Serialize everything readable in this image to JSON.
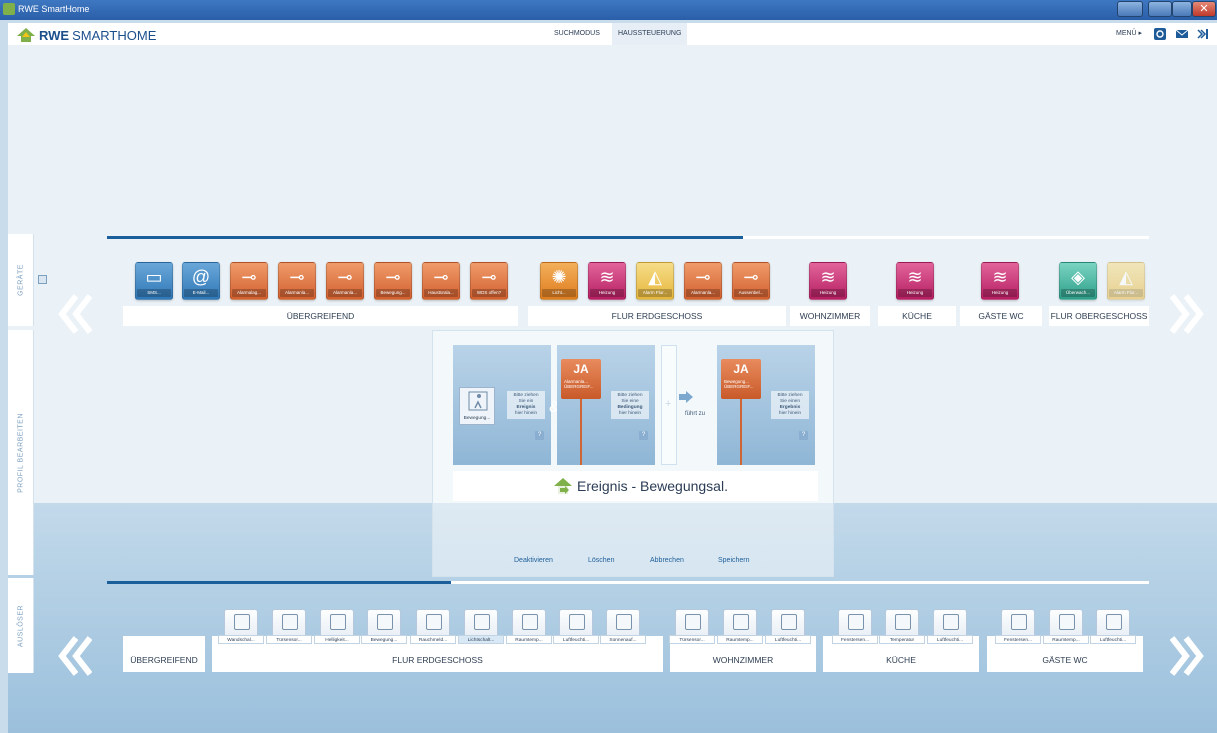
{
  "window": {
    "title": "RWE SmartHome",
    "close_glyph": "✕"
  },
  "header": {
    "logo_bold": "RWE",
    "logo_rest": "SMARTHOME",
    "modes": [
      "SUCHMODUS",
      "HAUSSTEUERUNG"
    ],
    "menu_label": "MENÜ ▸",
    "icons": [
      "refresh-icon",
      "mail-icon",
      "sidebar-toggle-icon"
    ]
  },
  "side_tabs": {
    "devices": "GERÄTE",
    "profile": "PROFIL BEARBEITEN",
    "trigger": "AUSLÖSER"
  },
  "devices": {
    "progress": 0.61,
    "groups": [
      {
        "name": "ÜBERGREIFEND"
      },
      {
        "name": "FLUR ERDGESCHOSS"
      },
      {
        "name": "WOHNZIMMER"
      },
      {
        "name": "KÜCHE"
      },
      {
        "name": "GÄSTE WC"
      },
      {
        "name": "FLUR OBERGESCHOSS"
      }
    ],
    "items": [
      {
        "label": "SMS...",
        "icon": "sms-icon",
        "color": "blue"
      },
      {
        "label": "E-Mail...",
        "icon": "email-at-icon",
        "color": "blue"
      },
      {
        "label": "Alarmalag...",
        "icon": "switch-icon",
        "color": "orange"
      },
      {
        "label": "Alarmanla...",
        "icon": "switch-icon",
        "color": "orange"
      },
      {
        "label": "Alarmanla...",
        "icon": "switch-icon",
        "color": "orange"
      },
      {
        "label": "Bewegung...",
        "icon": "switch-icon",
        "color": "orange"
      },
      {
        "label": "Haustüralа...",
        "icon": "switch-icon",
        "color": "orange"
      },
      {
        "label": "WDS offen?",
        "icon": "switch-icon",
        "color": "orange"
      },
      {
        "label": "Licht...",
        "icon": "light-bulb-icon",
        "color": "amber"
      },
      {
        "label": "Heizung",
        "icon": "heating-icon",
        "color": "magenta"
      },
      {
        "label": "Alarm Flur...",
        "icon": "alarm-bell-icon",
        "color": "yellow"
      },
      {
        "label": "Alarmanla...",
        "icon": "switch-icon",
        "color": "orange"
      },
      {
        "label": "Aussenbel...",
        "icon": "switch-icon",
        "color": "orange"
      },
      {
        "label": "Heizung",
        "icon": "heating-icon",
        "color": "magenta"
      },
      {
        "label": "Heizung",
        "icon": "heating-icon",
        "color": "magenta"
      },
      {
        "label": "Heizung",
        "icon": "heating-icon",
        "color": "magenta"
      },
      {
        "label": "Überwach...",
        "icon": "camera-icon",
        "color": "teal"
      },
      {
        "label": "Alarm Flur...",
        "icon": "alarm-bell-icon",
        "color": "yellow"
      }
    ]
  },
  "editor": {
    "trigger_label": "Bewegung...",
    "hint1": [
      "Bitte ziehen",
      "Sie ein",
      "Ereignis",
      "hier hinein"
    ],
    "ja1_title": "JA",
    "ja1_lines": [
      "Alarmanla...",
      "ÜBERGREIF..."
    ],
    "hint2": [
      "Bitte ziehen",
      "Sie eine",
      "Bedingung",
      "hier hinein"
    ],
    "plus": "+",
    "leads_to": "führt zu",
    "ja2_title": "JA",
    "ja2_lines": [
      "Bewegung...",
      "ÜBERGREIF..."
    ],
    "hint3": [
      "Bitte ziehen",
      "Sie einen",
      "Ergebnis",
      "hier hinein"
    ],
    "help": "?",
    "and": "&",
    "title": "Ereignis - Bewegungsal.",
    "buttons": [
      "Deaktivieren",
      "Löschen",
      "Abbrechen",
      "Speichern"
    ]
  },
  "triggers": {
    "progress": 0.33,
    "groups": [
      {
        "name": "ÜBERGREIFEND"
      },
      {
        "name": "FLUR ERDGESCHOSS"
      },
      {
        "name": "WOHNZIMMER"
      },
      {
        "name": "KÜCHE"
      },
      {
        "name": "GÄSTE WC"
      }
    ],
    "items": [
      {
        "label": "Wandschal...",
        "icon": "wall-switch-icon"
      },
      {
        "label": "Türsensor...",
        "icon": "door-sensor-icon"
      },
      {
        "label": "Helligkeit...",
        "icon": "brightness-icon"
      },
      {
        "label": "Bewegung...",
        "icon": "motion-icon"
      },
      {
        "label": "Rauchmeld...",
        "icon": "smoke-detector-icon"
      },
      {
        "label": "Lichtschalt...",
        "icon": "wall-switch-icon"
      },
      {
        "label": "Raumtemp...",
        "icon": "thermometer-icon"
      },
      {
        "label": "Luftfeuchti...",
        "icon": "humidity-icon"
      },
      {
        "label": "Sonnenauf...",
        "icon": "sunrise-icon"
      },
      {
        "label": "Türsensor...",
        "icon": "door-sensor-icon"
      },
      {
        "label": "Raumtemp...",
        "icon": "thermometer-icon"
      },
      {
        "label": "Luftfeuchti...",
        "icon": "humidity-icon"
      },
      {
        "label": "Fenstersen...",
        "icon": "window-sensor-icon"
      },
      {
        "label": "Temperatur",
        "icon": "thermometer-icon"
      },
      {
        "label": "Luftfeuchti...",
        "icon": "humidity-icon"
      },
      {
        "label": "Fenstersen...",
        "icon": "window-sensor-icon"
      },
      {
        "label": "Raumtemp...",
        "icon": "thermometer-icon"
      },
      {
        "label": "Luftfeuchti...",
        "icon": "humidity-icon"
      }
    ]
  }
}
